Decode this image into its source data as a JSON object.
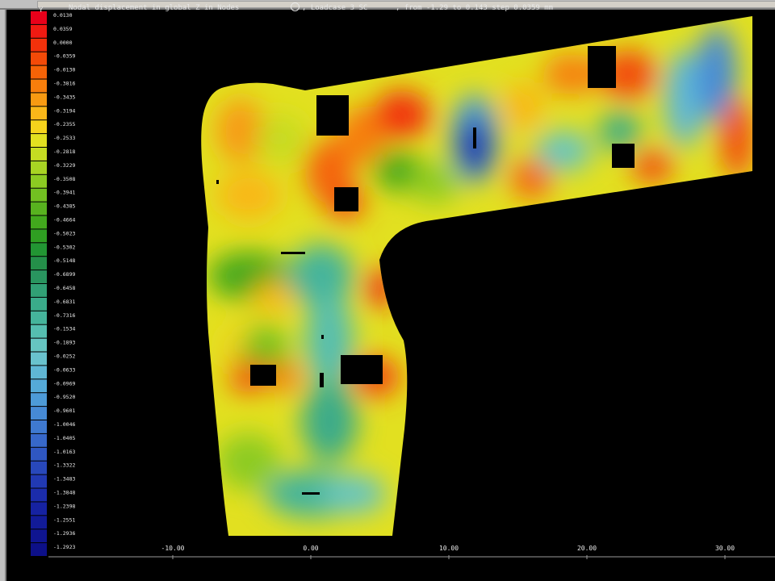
{
  "legend": {
    "labels": [
      "0.0130",
      "0.0359",
      "0.0000",
      "-0.0359",
      "-0.0130",
      "-0.3816",
      "-0.3435",
      "-0.3194",
      "-0.2355",
      "-0.2533",
      "-0.2818",
      "-0.3229",
      "-0.3508",
      "-0.3941",
      "-0.4385",
      "-0.4664",
      "-0.5023",
      "-0.5302",
      "-0.5148",
      "-0.6899",
      "-0.6458",
      "-0.6831",
      "-0.7316",
      "-0.1534",
      "-0.1893",
      "-0.0252",
      "-0.0633",
      "-0.0969",
      "-0.9520",
      "-0.9601",
      "-1.0046",
      "-1.0405",
      "-1.0163",
      "-1.3322",
      "-1.3483",
      "-1.3848",
      "-1.2398",
      "-1.2551",
      "-1.2936",
      "-1.2923"
    ],
    "colors": [
      "#e8001a",
      "#f01a12",
      "#f2310b",
      "#f34a08",
      "#f56307",
      "#f77e0c",
      "#f89a12",
      "#f9b719",
      "#f5d31c",
      "#e2e020",
      "#c5dc22",
      "#a8d423",
      "#8ccb22",
      "#72c021",
      "#58b21f",
      "#42a81d",
      "#2f9e22",
      "#229633",
      "#248f49",
      "#29955f",
      "#31a075",
      "#3aab8a",
      "#45b49b",
      "#55beb0",
      "#66c5c1",
      "#69c2cd",
      "#5fb7d5",
      "#55aad8",
      "#4d9bd8",
      "#468ad5",
      "#3f79d0",
      "#3768ca",
      "#2f57c2",
      "#2848bb",
      "#2139b3",
      "#1b2cab",
      "#1622a2",
      "#121b98",
      "#0f1590",
      "#0d1088"
    ]
  },
  "axis": {
    "ticks": [
      "-10.00",
      "0.00",
      "10.00",
      "20.00",
      "30.00"
    ]
  },
  "status": {
    "axis_label": "Y",
    "message": "Nodal displacement in global Z in Nodes",
    "loadcase": ", Loadcase 3 SC",
    "range": ", from -1.29 to 0.143 step 0.0359 mm"
  },
  "colors": {
    "background": "#000000",
    "window_chrome": "#c0c0c0",
    "text": "#e8e8e8"
  }
}
